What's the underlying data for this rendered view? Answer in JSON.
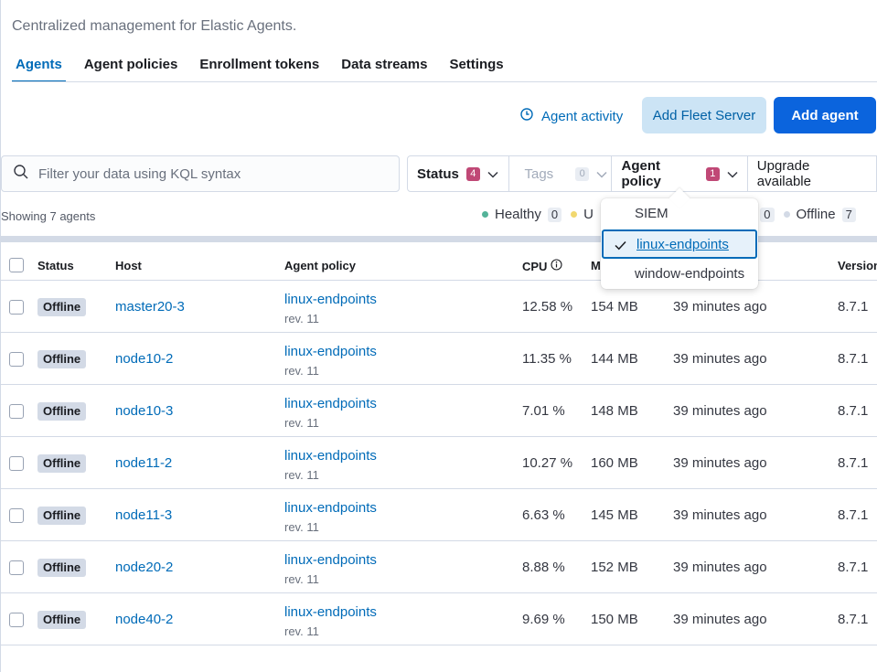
{
  "header": {
    "subtitle": "Centralized management for Elastic Agents."
  },
  "tabs": [
    {
      "label": "Agents",
      "active": true
    },
    {
      "label": "Agent policies",
      "active": false
    },
    {
      "label": "Enrollment tokens",
      "active": false
    },
    {
      "label": "Data streams",
      "active": false
    },
    {
      "label": "Settings",
      "active": false
    }
  ],
  "actions": {
    "activity_label": "Agent activity",
    "fleet_server_label": "Add Fleet Server",
    "add_agent_label": "Add agent"
  },
  "search": {
    "placeholder": "Filter your data using KQL syntax"
  },
  "filters": {
    "status": {
      "label": "Status",
      "count": "4"
    },
    "tags": {
      "label": "Tags",
      "count": "0"
    },
    "policy": {
      "label": "Agent policy",
      "count": "1"
    },
    "upgrade": {
      "label": "Upgrade available"
    }
  },
  "summary": {
    "showing": "Showing 7 agents",
    "healthy_label": "Healthy",
    "healthy_count": "0",
    "unhealthy_label_fragment": "U",
    "updating_label_fragment": "g",
    "updating_count": "0",
    "offline_label": "Offline",
    "offline_count": "7"
  },
  "table": {
    "headers": {
      "status": "Status",
      "host": "Host",
      "policy": "Agent policy",
      "cpu": "CPU",
      "memory": "M",
      "version": "Version"
    },
    "rows": [
      {
        "status": "Offline",
        "host": "master20-3",
        "policy": "linux-endpoints",
        "rev": "rev. 11",
        "cpu": "12.58 %",
        "mem": "154 MB",
        "last_activity": "39 minutes ago",
        "version": "8.7.1"
      },
      {
        "status": "Offline",
        "host": "node10-2",
        "policy": "linux-endpoints",
        "rev": "rev. 11",
        "cpu": "11.35 %",
        "mem": "144 MB",
        "last_activity": "39 minutes ago",
        "version": "8.7.1"
      },
      {
        "status": "Offline",
        "host": "node10-3",
        "policy": "linux-endpoints",
        "rev": "rev. 11",
        "cpu": "7.01 %",
        "mem": "148 MB",
        "last_activity": "39 minutes ago",
        "version": "8.7.1"
      },
      {
        "status": "Offline",
        "host": "node11-2",
        "policy": "linux-endpoints",
        "rev": "rev. 11",
        "cpu": "10.27 %",
        "mem": "160 MB",
        "last_activity": "39 minutes ago",
        "version": "8.7.1"
      },
      {
        "status": "Offline",
        "host": "node11-3",
        "policy": "linux-endpoints",
        "rev": "rev. 11",
        "cpu": "6.63 %",
        "mem": "145 MB",
        "last_activity": "39 minutes ago",
        "version": "8.7.1"
      },
      {
        "status": "Offline",
        "host": "node20-2",
        "policy": "linux-endpoints",
        "rev": "rev. 11",
        "cpu": "8.88 %",
        "mem": "152 MB",
        "last_activity": "39 minutes ago",
        "version": "8.7.1"
      },
      {
        "status": "Offline",
        "host": "node40-2",
        "policy": "linux-endpoints",
        "rev": "rev. 11",
        "cpu": "9.69 %",
        "mem": "150 MB",
        "last_activity": "39 minutes ago",
        "version": "8.7.1"
      }
    ]
  },
  "policy_dropdown": {
    "options": [
      {
        "label": "SIEM",
        "selected": false
      },
      {
        "label": "linux-endpoints",
        "selected": true
      },
      {
        "label": "window-endpoints",
        "selected": false
      }
    ]
  },
  "colors": {
    "primary": "#0b64dd",
    "link": "#006bb8",
    "accent_badge": "#c04876",
    "healthy": "#54b399",
    "unhealthy": "#f1d86f",
    "offline": "#d3dae6"
  }
}
